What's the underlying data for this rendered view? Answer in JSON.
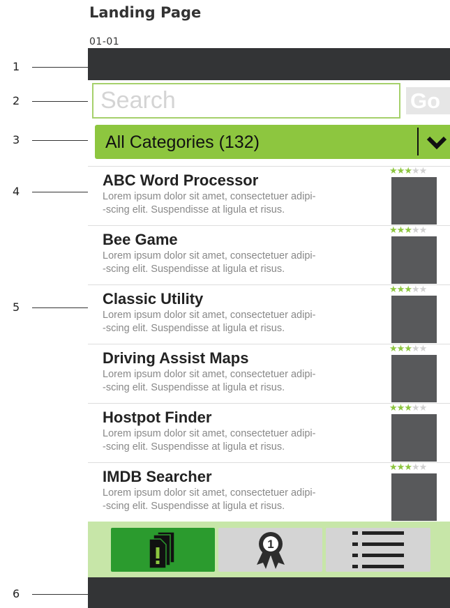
{
  "header": {
    "title": "Landing Page",
    "code": "01-01"
  },
  "callouts": [
    "1",
    "2",
    "3",
    "4",
    "5",
    "6"
  ],
  "search": {
    "placeholder": "Search",
    "go_label": "Go"
  },
  "category": {
    "label": "All Categories (132)",
    "icon": "chevron-down-icon"
  },
  "apps": [
    {
      "title": "ABC Word Processor",
      "desc_line1": "Lorem ipsum dolor sit amet, consectetuer adipi-",
      "desc_line2": "-scing elit. Suspendisse at ligula et risus.",
      "rating": 3,
      "max_rating": 5
    },
    {
      "title": "Bee Game",
      "desc_line1": "Lorem ipsum dolor sit amet, consectetuer adipi-",
      "desc_line2": "-scing elit. Suspendisse at ligula et risus.",
      "rating": 3,
      "max_rating": 5
    },
    {
      "title": "Classic Utility",
      "desc_line1": "Lorem ipsum dolor sit amet, consectetuer adipi-",
      "desc_line2": "-scing elit. Suspendisse at ligula et risus.",
      "rating": 3,
      "max_rating": 5
    },
    {
      "title": "Driving Assist Maps",
      "desc_line1": "Lorem ipsum dolor sit amet, consectetuer adipi-",
      "desc_line2": "-scing elit. Suspendisse at ligula et risus.",
      "rating": 3,
      "max_rating": 5
    },
    {
      "title": "Hostpot Finder",
      "desc_line1": "Lorem ipsum dolor sit amet, consectetuer adipi-",
      "desc_line2": "-scing elit. Suspendisse at ligula et risus.",
      "rating": 3,
      "max_rating": 5
    },
    {
      "title": "IMDB Searcher",
      "desc_line1": "Lorem ipsum dolor sit amet, consectetuer adipi-",
      "desc_line2": "-scing elit. Suspendisse at ligula et risus.",
      "rating": 3,
      "max_rating": 5
    }
  ],
  "tabs": [
    {
      "name": "featured",
      "icon": "new-apps-icon",
      "active": true
    },
    {
      "name": "top-rated",
      "icon": "award-ribbon-icon",
      "badge": "1",
      "active": false
    },
    {
      "name": "list",
      "icon": "list-icon",
      "active": false
    }
  ],
  "colors": {
    "accent_green": "#8dc63f",
    "active_tab_green": "#2b9b2e",
    "tab_bar_bg": "#c7e6a8",
    "dark_bar": "#333436",
    "thumbnail": "#58595b",
    "star_empty": "#d0d0d0"
  }
}
